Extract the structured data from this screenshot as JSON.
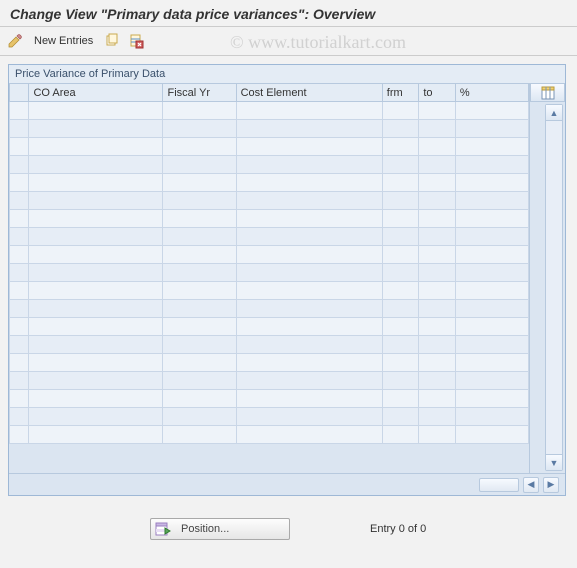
{
  "title": "Change View \"Primary data price variances\": Overview",
  "toolbar": {
    "new_entries_label": "New Entries"
  },
  "watermark": "© www.tutorialkart.com",
  "panel": {
    "title": "Price Variance of Primary Data",
    "columns": {
      "co_area": "CO Area",
      "fiscal_yr": "Fiscal Yr",
      "cost_element": "Cost Element",
      "frm": "frm",
      "to": "to",
      "pct": "%"
    },
    "row_count": 19,
    "rows": []
  },
  "footer": {
    "position_label": "Position...",
    "entry_text": "Entry 0 of 0"
  }
}
